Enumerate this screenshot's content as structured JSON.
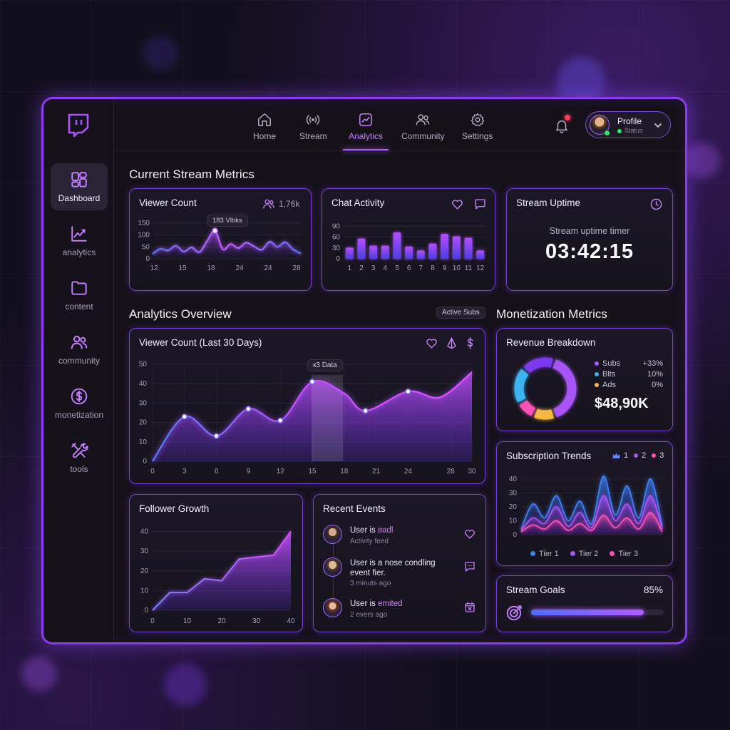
{
  "nav": {
    "items": [
      {
        "label": "Home",
        "icon": "home-icon"
      },
      {
        "label": "Stream",
        "icon": "broadcast-icon"
      },
      {
        "label": "Analytics",
        "icon": "analytics-icon",
        "active": true
      },
      {
        "label": "Community",
        "icon": "people-icon"
      },
      {
        "label": "Settings",
        "icon": "gear-icon"
      }
    ],
    "profile_name": "Profile",
    "profile_status": "Status"
  },
  "sidebar": {
    "items": [
      {
        "label": "Dashboard",
        "icon": "dashboard-icon",
        "active": true
      },
      {
        "label": "analytics",
        "icon": "trend-icon"
      },
      {
        "label": "content",
        "icon": "folder-icon"
      },
      {
        "label": "community",
        "icon": "people-icon"
      },
      {
        "label": "monetization",
        "icon": "dollar-icon"
      },
      {
        "label": "tools",
        "icon": "tools-icon"
      }
    ]
  },
  "sections": {
    "current": "Current Stream Metrics",
    "overview": "Analytics Overview",
    "overview_pill": "Active Subs",
    "monetization": "Monetization Metrics"
  },
  "viewer_count": {
    "title": "Viewer Count",
    "count": "1,76k",
    "tooltip": "183 Vlbks"
  },
  "chat_activity": {
    "title": "Chat Activity"
  },
  "uptime": {
    "title": "Stream Uptime",
    "label": "Stream uptime timer",
    "time": "03:42:15"
  },
  "viewer30": {
    "title": "Viewer Count (Last 30 Days)",
    "tooltip": "к3 Data"
  },
  "revenue": {
    "title": "Revenue Breakdown",
    "legend": [
      {
        "name": "Subs",
        "value": "+33%",
        "color": "#a855f7"
      },
      {
        "name": "Blts",
        "value": "10%",
        "color": "#3bb4f2"
      },
      {
        "name": "Ads",
        "value": "0%",
        "color": "#f5b941"
      }
    ],
    "total": "$48,90K"
  },
  "sub_trends": {
    "title": "Subscription Trends",
    "header_legend": [
      "1",
      "2",
      "3"
    ],
    "legend": [
      "Tier 1",
      "Tier 2",
      "Tier 3"
    ]
  },
  "goals": {
    "title": "Stream Goals",
    "percent": "85%"
  },
  "follower": {
    "title": "Follower Growth"
  },
  "events": {
    "title": "Recent Events",
    "items": [
      {
        "text": "User is ",
        "highlight": "вadl",
        "sub": "Activity feed",
        "icon": "heart-icon"
      },
      {
        "text": "User is a nose condling event fier.",
        "highlight": "",
        "sub": "3 minuts ago",
        "icon": "chat-icon"
      },
      {
        "text": "User is ",
        "highlight": "emited",
        "sub": "2 evers ago",
        "icon": "calendar-x-icon"
      }
    ]
  },
  "chart_data": [
    {
      "type": "line",
      "title": "Viewer Count",
      "x_ticks": [
        12,
        15,
        18,
        24,
        24,
        28
      ],
      "y_ticks": [
        0,
        50,
        100,
        150
      ],
      "x": [
        1,
        2,
        3,
        4,
        5,
        6,
        7,
        8,
        9,
        10,
        11,
        12,
        13,
        14,
        15,
        16,
        17,
        18,
        19,
        20
      ],
      "values": [
        20,
        42,
        35,
        55,
        30,
        48,
        28,
        75,
        118,
        40,
        62,
        45,
        68,
        52,
        38,
        72,
        50,
        70,
        40,
        22
      ],
      "ylim": [
        0,
        150
      ]
    },
    {
      "type": "bar",
      "title": "Chat Activity",
      "categories": [
        "1",
        "2",
        "3",
        "4",
        "5",
        "6",
        "7",
        "8",
        "9",
        "10",
        "11",
        "12"
      ],
      "values": [
        31,
        56,
        36,
        36,
        73,
        34,
        23,
        42,
        69,
        62,
        58,
        23
      ],
      "y_ticks": [
        0,
        30,
        60,
        90
      ],
      "ylim": [
        0,
        95
      ]
    },
    {
      "type": "area",
      "title": "Viewer Count (Last 30 Days)",
      "x_ticks": [
        0,
        3,
        6,
        9,
        12,
        15,
        18,
        21,
        24,
        28,
        30
      ],
      "y_ticks": [
        0,
        10,
        20,
        30,
        40,
        50
      ],
      "points": [
        [
          0,
          0
        ],
        [
          3,
          23
        ],
        [
          6,
          13
        ],
        [
          9,
          27
        ],
        [
          12,
          21
        ],
        [
          15,
          41
        ],
        [
          18,
          35
        ],
        [
          20,
          26
        ],
        [
          24,
          36
        ],
        [
          27,
          33
        ],
        [
          30,
          46
        ]
      ],
      "ylim": [
        0,
        50
      ]
    },
    {
      "type": "pie",
      "title": "Revenue Breakdown",
      "segments": [
        {
          "name": "Subs",
          "value": 40,
          "color": "#a855f7"
        },
        {
          "name": "Ads",
          "value": 12,
          "color": "#f5b941"
        },
        {
          "name": "pink",
          "value": 10,
          "color": "#ff4fb8"
        },
        {
          "name": "Blts",
          "value": 20,
          "color": "#3bb4f2"
        },
        {
          "name": "violet",
          "value": 18,
          "color": "#7c3aed"
        }
      ]
    },
    {
      "type": "area",
      "title": "Subscription Trends",
      "y_ticks": [
        0,
        10,
        20,
        30,
        40
      ],
      "ylim": [
        0,
        45
      ],
      "series": [
        {
          "name": "Tier 1",
          "color": "#3b82f6",
          "values": [
            4,
            22,
            12,
            28,
            10,
            24,
            8,
            42,
            14,
            35,
            12,
            40,
            6
          ]
        },
        {
          "name": "Tier 2",
          "color": "#a855f7",
          "values": [
            3,
            12,
            8,
            20,
            6,
            16,
            5,
            28,
            10,
            22,
            8,
            28,
            4
          ]
        },
        {
          "name": "Tier 3",
          "color": "#ff4fb8",
          "values": [
            2,
            7,
            4,
            10,
            3,
            8,
            3,
            14,
            5,
            12,
            4,
            16,
            2
          ]
        }
      ]
    },
    {
      "type": "area",
      "title": "Follower Growth",
      "x_ticks": [
        0,
        10,
        20,
        30,
        40
      ],
      "y_ticks": [
        0,
        10,
        20,
        30,
        40
      ],
      "points": [
        [
          0,
          0
        ],
        [
          5,
          9
        ],
        [
          10,
          9
        ],
        [
          15,
          16
        ],
        [
          20,
          15
        ],
        [
          25,
          26
        ],
        [
          30,
          27
        ],
        [
          35,
          28
        ],
        [
          40,
          40
        ]
      ],
      "ylim": [
        0,
        42
      ]
    },
    {
      "type": "bar",
      "title": "Stream Goals",
      "values": [
        85
      ]
    }
  ]
}
